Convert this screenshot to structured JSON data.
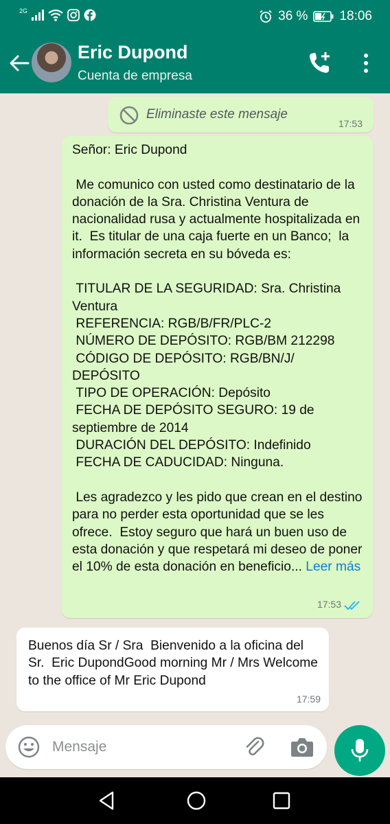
{
  "status_bar": {
    "network": "2G",
    "battery": "36 %",
    "time": "18:06"
  },
  "header": {
    "contact_name": "Eric Dupond",
    "contact_subtitle": "Cuenta de empresa"
  },
  "messages": {
    "deleted": {
      "text": "Eliminaste este mensaje",
      "time": "17:53"
    },
    "long": {
      "text": "Señor: Eric Dupond\n\n Me comunico con usted como destinatario de la donación de la Sra. Christina Ventura de nacionalidad rusa y actualmente hospitalizada en it.  Es titular de una caja fuerte en un Banco;  la información secreta en su bóveda es:\n\n TITULAR DE LA SEGURIDAD: Sra. Christina Ventura\n REFERENCIA: RGB/B/FR/PLC-2\n NÚMERO DE DEPÓSITO: RGB/BM 212298\n CÓDIGO DE DEPÓSITO: RGB/BN/J/ DEPÓSITO\n TIPO DE OPERACIÓN: Depósito\n FECHA DE DEPÓSITO SEGURO: 19 de septiembre de 2014\n DURACIÓN DEL DEPÓSITO: Indefinido\n FECHA DE CADUCIDAD: Ninguna.\n\n Les agradezco y les pido que crean en el destino para no perder esta oportunidad que se les ofrece.  Estoy seguro que hará un buen uso de esta donación y que respetará mi deseo de poner el 10% de esta donación en beneficio... ",
      "read_more": "Leer más",
      "time": "17:53"
    },
    "incoming": {
      "text": "Buenos día Sr / Sra  Bienvenido a la oficina del Sr.  Eric DupondGood morning Mr / Mrs Welcome to the office of Mr Eric Dupond",
      "time": "17:59"
    }
  },
  "input": {
    "placeholder": "Mensaje"
  },
  "colors": {
    "header": "#00806c",
    "outgoing_bubble": "#dcf8c6",
    "incoming_bubble": "#ffffff",
    "chat_background": "#ece5dd",
    "mic_button": "#00a884",
    "read_ticks": "#34b7f1",
    "link": "#0b7fd1"
  },
  "icons": [
    "back-arrow-icon",
    "add-call-icon",
    "more-vert-icon",
    "blocked-icon",
    "double-check-icon",
    "emoji-icon",
    "attach-icon",
    "camera-icon",
    "mic-icon",
    "alarm-icon",
    "wifi-icon",
    "instagram-icon",
    "facebook-icon"
  ]
}
